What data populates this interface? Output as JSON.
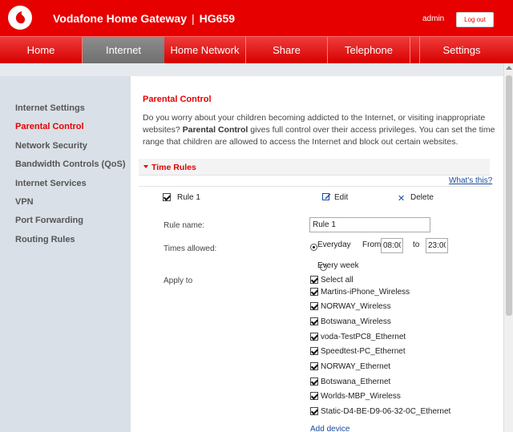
{
  "header": {
    "brand": "Vodafone Home Gateway",
    "model": "HG659",
    "separator": "|",
    "user": "admin",
    "logout_label": "Log out"
  },
  "nav": {
    "home": "Home",
    "internet": "Internet",
    "home_network": "Home Network",
    "share": "Share",
    "telephone": "Telephone",
    "settings": "Settings"
  },
  "sidebar": {
    "items": [
      {
        "label": "Internet Settings"
      },
      {
        "label": "Parental Control"
      },
      {
        "label": "Network Security"
      },
      {
        "label": "Bandwidth Controls (QoS)"
      },
      {
        "label": "Internet Services"
      },
      {
        "label": "VPN"
      },
      {
        "label": "Port Forwarding"
      },
      {
        "label": "Routing Rules"
      }
    ]
  },
  "main": {
    "title": "Parental Control",
    "intro_line1": "Do you worry about your children becoming addicted to the Internet, or visiting inappropriate websites?",
    "intro_bold": "Parental Control",
    "intro_rest": " gives full control over their access privileges. You can set the time range that children are allowed to access the Internet and block out certain websites.",
    "section_title": "Time Rules",
    "whats_this": "What's this?",
    "rule": {
      "title": "Rule 1",
      "edit_label": "Edit",
      "delete_label": "Delete",
      "delete_glyph": "✕",
      "name_label": "Rule name:",
      "name_value": "Rule 1",
      "times_label": "Times allowed:",
      "everyday_label": "Everyday",
      "from_label": "From",
      "from_value": "08:00",
      "to_label": "to",
      "to_value": "23:00",
      "every_week_label": "Every week",
      "apply_label": "Apply to",
      "select_all_label": "Select all",
      "devices": [
        "Martins-iPhone_Wireless",
        "NORWAY_Wireless",
        "Botswana_Wireless",
        "voda-TestPC8_Ethernet",
        "Speedtest-PC_Ethernet",
        "NORWAY_Ethernet",
        "Botswana_Ethernet",
        "Worlds-MBP_Wireless",
        "Static-D4-BE-D9-06-32-0C_Ethernet"
      ],
      "add_device": "Add device"
    }
  },
  "colors": {
    "brand_red": "#e60000",
    "link_blue": "#1a4a9a",
    "sidebar_bg": "#d9e0e7",
    "active_tab": "#7a7a7a"
  }
}
